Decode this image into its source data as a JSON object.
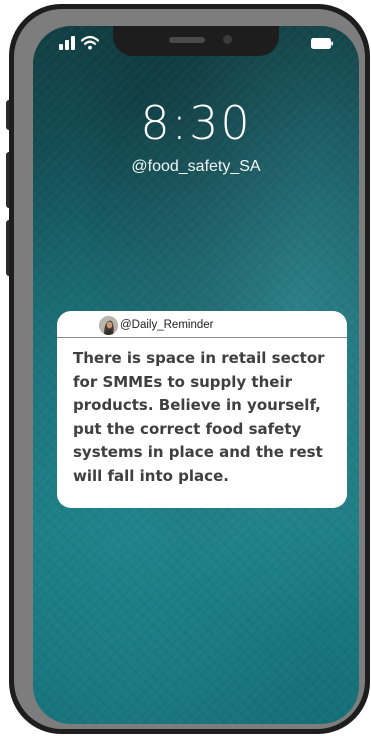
{
  "lock_screen": {
    "time": "8:30",
    "handle": "@food_safety_SA"
  },
  "notification": {
    "sender": "@Daily_Reminder",
    "message": "There is space in retail sector for SMMEs to supply their products. Believe in yourself, put the correct food safety systems in place and the rest will fall into place."
  },
  "status_bar": {
    "icons": [
      "signal-icon",
      "wifi-icon",
      "battery-icon"
    ]
  },
  "colors": {
    "screen_top": "#113f43",
    "screen_mid": "#1a6e75",
    "screen_bottom": "#157078",
    "card_background": "#ffffff",
    "message_text": "#3f3f3f",
    "phone_frame": "#1d1d1d"
  }
}
